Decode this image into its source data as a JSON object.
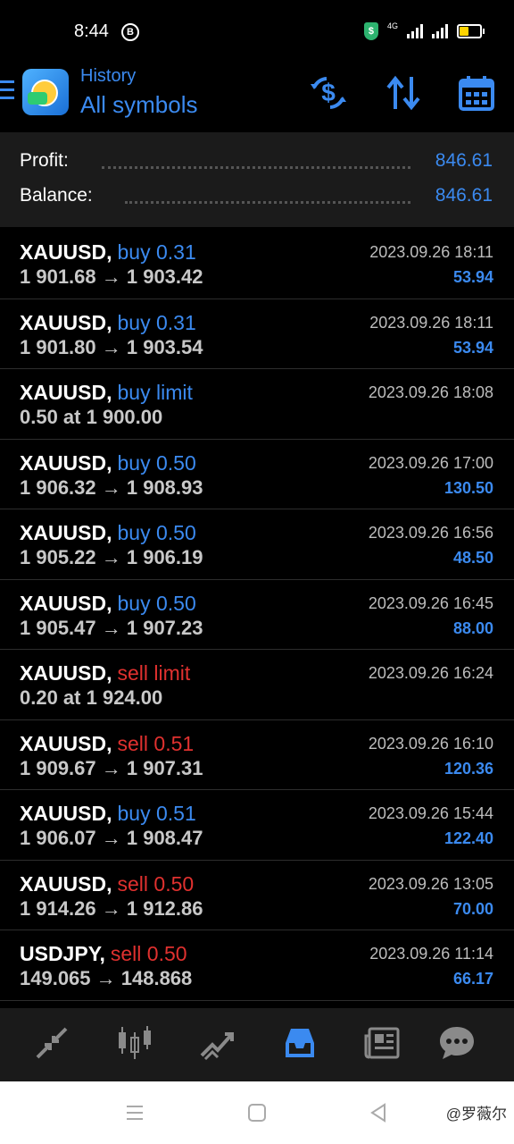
{
  "status_bar": {
    "time": "8:44",
    "badge": "B",
    "network": "4G"
  },
  "header": {
    "title": "History",
    "subtitle": "All symbols"
  },
  "summary": {
    "profit_label": "Profit:",
    "profit_value": "846.61",
    "balance_label": "Balance:",
    "balance_value": "846.61"
  },
  "deals": [
    {
      "symbol": "XAUUSD,",
      "side": "buy 0.31",
      "type": "buy",
      "prices": "1 901.68 → 1 903.42",
      "time": "2023.09.26 18:11",
      "profit": "53.94"
    },
    {
      "symbol": "XAUUSD,",
      "side": "buy 0.31",
      "type": "buy",
      "prices": "1 901.80 → 1 903.54",
      "time": "2023.09.26 18:11",
      "profit": "53.94"
    },
    {
      "symbol": "XAUUSD,",
      "side": "buy limit",
      "type": "buy",
      "prices": "0.50 at 1 900.00",
      "time": "2023.09.26 18:08",
      "profit": ""
    },
    {
      "symbol": "XAUUSD,",
      "side": "buy 0.50",
      "type": "buy",
      "prices": "1 906.32 → 1 908.93",
      "time": "2023.09.26 17:00",
      "profit": "130.50"
    },
    {
      "symbol": "XAUUSD,",
      "side": "buy 0.50",
      "type": "buy",
      "prices": "1 905.22 → 1 906.19",
      "time": "2023.09.26 16:56",
      "profit": "48.50"
    },
    {
      "symbol": "XAUUSD,",
      "side": "buy 0.50",
      "type": "buy",
      "prices": "1 905.47 → 1 907.23",
      "time": "2023.09.26 16:45",
      "profit": "88.00"
    },
    {
      "symbol": "XAUUSD,",
      "side": "sell limit",
      "type": "sell",
      "prices": "0.20 at 1 924.00",
      "time": "2023.09.26 16:24",
      "profit": ""
    },
    {
      "symbol": "XAUUSD,",
      "side": "sell 0.51",
      "type": "sell",
      "prices": "1 909.67 → 1 907.31",
      "time": "2023.09.26 16:10",
      "profit": "120.36"
    },
    {
      "symbol": "XAUUSD,",
      "side": "buy 0.51",
      "type": "buy",
      "prices": "1 906.07 → 1 908.47",
      "time": "2023.09.26 15:44",
      "profit": "122.40"
    },
    {
      "symbol": "XAUUSD,",
      "side": "sell 0.50",
      "type": "sell",
      "prices": "1 914.26 → 1 912.86",
      "time": "2023.09.26 13:05",
      "profit": "70.00"
    },
    {
      "symbol": "USDJPY,",
      "side": "sell 0.50",
      "type": "sell",
      "prices": "149.065 → 148.868",
      "time": "2023.09.26 11:14",
      "profit": "66.17"
    }
  ],
  "bottom_nav": [
    "quotes-icon",
    "chart-icon",
    "trade-icon",
    "history-icon",
    "news-icon",
    "chat-icon"
  ],
  "watermark": "@罗薇尔",
  "colors": {
    "accent": "#3b8af0",
    "sell": "#e0312f",
    "background": "#000000",
    "panel": "#1b1b1b"
  }
}
